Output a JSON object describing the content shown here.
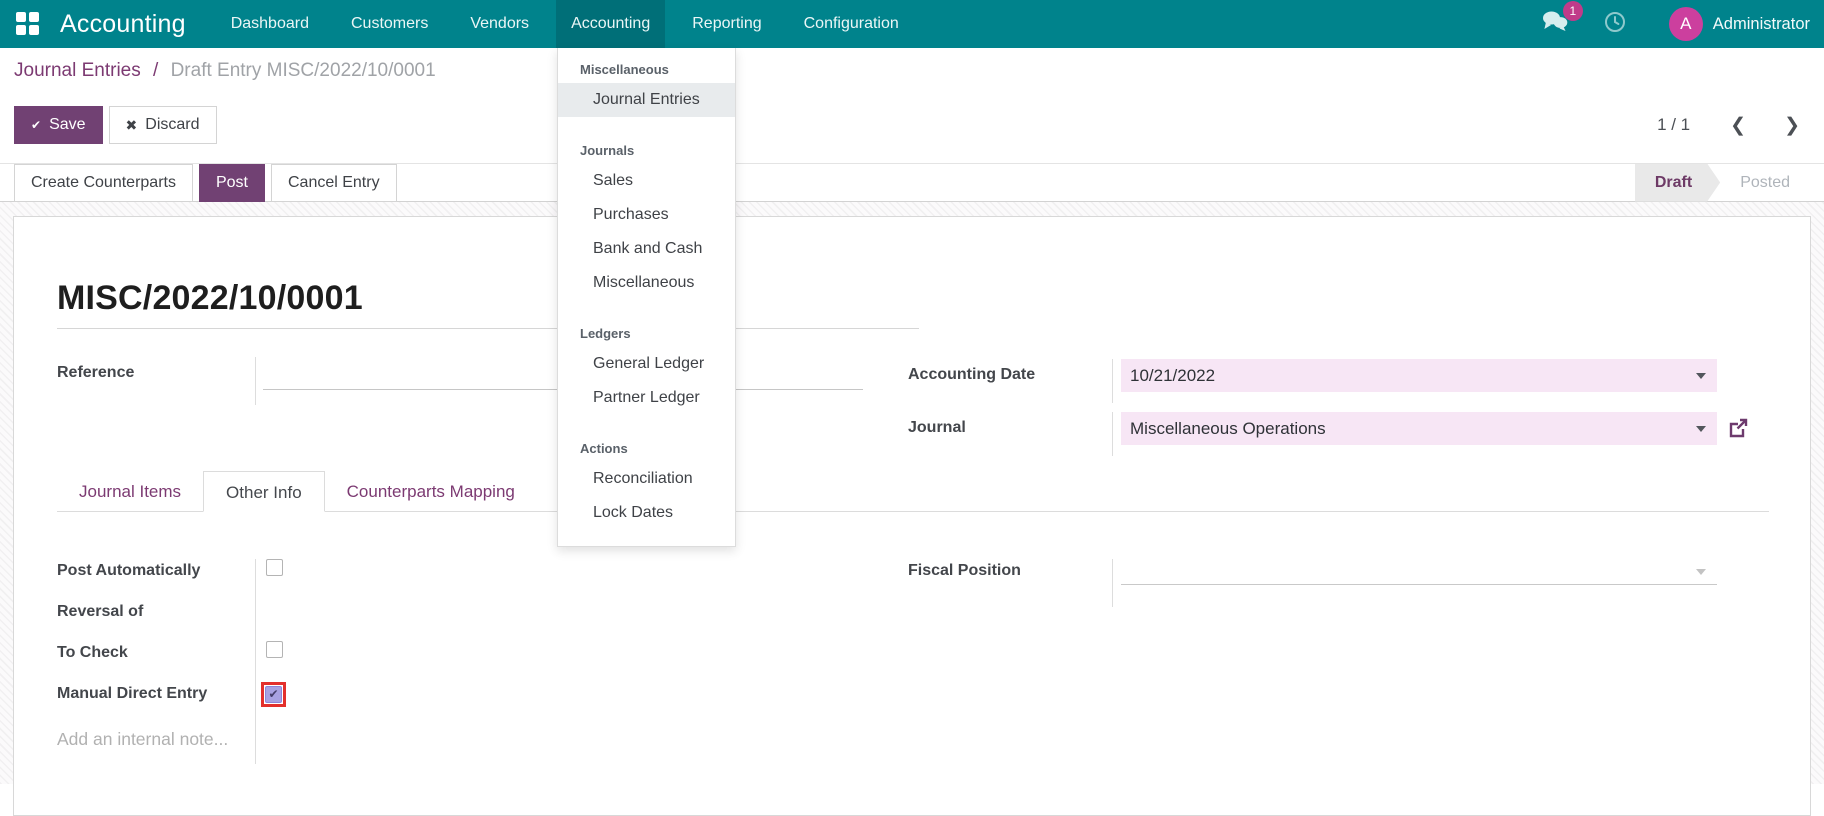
{
  "colors": {
    "navbar_teal": "#00838c",
    "navbar_active_teal": "#006f78",
    "primary_purple": "#714173",
    "link_purple": "#7c3a72",
    "field_highlight_pink": "#f7e6f5",
    "checked_checkbox_fill": "#a8a2e2",
    "attention_ring_red": "#e3302c",
    "badge_magenta": "#c13b8a",
    "avatar_magenta": "#cc3f9e",
    "state_active_bg": "#e9e9e9"
  },
  "navbar": {
    "brand": "Accounting",
    "items": [
      {
        "label": "Dashboard",
        "active": false
      },
      {
        "label": "Customers",
        "active": false
      },
      {
        "label": "Vendors",
        "active": false
      },
      {
        "label": "Accounting",
        "active": true
      },
      {
        "label": "Reporting",
        "active": false
      },
      {
        "label": "Configuration",
        "active": false
      }
    ],
    "messages_badge": "1",
    "user": {
      "initial": "A",
      "name": "Administrator"
    }
  },
  "breadcrumb": {
    "parent": "Journal Entries",
    "separator": "/",
    "current": "Draft Entry MISC/2022/10/0001"
  },
  "control_panel": {
    "save_label": "Save",
    "save_icon": "✔",
    "discard_label": "Discard",
    "discard_icon": "✖",
    "pager": "1 / 1",
    "pager_prev_icon": "❮",
    "pager_next_icon": "❯"
  },
  "statusbar": {
    "buttons": [
      {
        "label": "Create Counterparts",
        "primary": false
      },
      {
        "label": "Post",
        "primary": true
      },
      {
        "label": "Cancel Entry",
        "primary": false
      }
    ],
    "states": [
      {
        "label": "Draft",
        "active": true
      },
      {
        "label": "Posted",
        "active": false
      }
    ]
  },
  "accounting_menu": {
    "sections": [
      {
        "header": "Miscellaneous",
        "items": [
          {
            "label": "Journal Entries",
            "active": true
          }
        ]
      },
      {
        "header": "Journals",
        "items": [
          {
            "label": "Sales"
          },
          {
            "label": "Purchases"
          },
          {
            "label": "Bank and Cash"
          },
          {
            "label": "Miscellaneous"
          }
        ]
      },
      {
        "header": "Ledgers",
        "items": [
          {
            "label": "General Ledger"
          },
          {
            "label": "Partner Ledger"
          }
        ]
      },
      {
        "header": "Actions",
        "items": [
          {
            "label": "Reconciliation"
          },
          {
            "label": "Lock Dates"
          }
        ]
      }
    ]
  },
  "form": {
    "title": "MISC/2022/10/0001",
    "reference": {
      "label": "Reference",
      "value": ""
    },
    "accounting_date": {
      "label": "Accounting Date",
      "value": "10/21/2022"
    },
    "journal": {
      "label": "Journal",
      "value": "Miscellaneous Operations"
    },
    "tabs": [
      {
        "label": "Journal Items",
        "active": false
      },
      {
        "label": "Other Info",
        "active": true
      },
      {
        "label": "Counterparts Mapping",
        "active": false
      }
    ],
    "other_info": {
      "post_automatically": {
        "label": "Post Automatically",
        "checked": false
      },
      "reversal_of": {
        "label": "Reversal of",
        "value": ""
      },
      "to_check": {
        "label": "To Check",
        "checked": false
      },
      "manual_direct_entry": {
        "label": "Manual Direct Entry",
        "checked": true,
        "highlighted": true,
        "check_glyph": "✔"
      },
      "fiscal_position": {
        "label": "Fiscal Position",
        "value": ""
      }
    },
    "note_placeholder": "Add an internal note..."
  }
}
